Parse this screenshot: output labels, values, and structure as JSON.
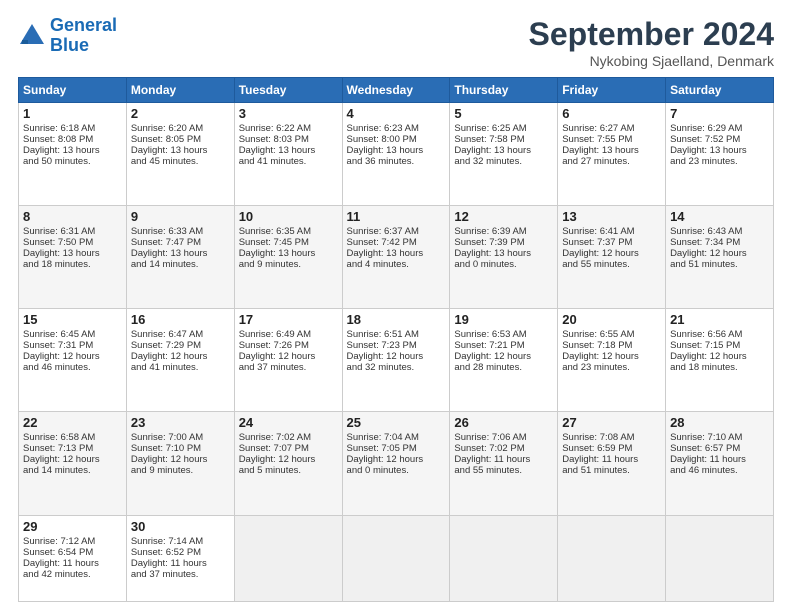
{
  "logo": {
    "line1": "General",
    "line2": "Blue"
  },
  "header": {
    "month": "September 2024",
    "location": "Nykobing Sjaelland, Denmark"
  },
  "days_of_week": [
    "Sunday",
    "Monday",
    "Tuesday",
    "Wednesday",
    "Thursday",
    "Friday",
    "Saturday"
  ],
  "weeks": [
    [
      {
        "day": "1",
        "lines": [
          "Sunrise: 6:18 AM",
          "Sunset: 8:08 PM",
          "Daylight: 13 hours",
          "and 50 minutes."
        ]
      },
      {
        "day": "2",
        "lines": [
          "Sunrise: 6:20 AM",
          "Sunset: 8:05 PM",
          "Daylight: 13 hours",
          "and 45 minutes."
        ]
      },
      {
        "day": "3",
        "lines": [
          "Sunrise: 6:22 AM",
          "Sunset: 8:03 PM",
          "Daylight: 13 hours",
          "and 41 minutes."
        ]
      },
      {
        "day": "4",
        "lines": [
          "Sunrise: 6:23 AM",
          "Sunset: 8:00 PM",
          "Daylight: 13 hours",
          "and 36 minutes."
        ]
      },
      {
        "day": "5",
        "lines": [
          "Sunrise: 6:25 AM",
          "Sunset: 7:58 PM",
          "Daylight: 13 hours",
          "and 32 minutes."
        ]
      },
      {
        "day": "6",
        "lines": [
          "Sunrise: 6:27 AM",
          "Sunset: 7:55 PM",
          "Daylight: 13 hours",
          "and 27 minutes."
        ]
      },
      {
        "day": "7",
        "lines": [
          "Sunrise: 6:29 AM",
          "Sunset: 7:52 PM",
          "Daylight: 13 hours",
          "and 23 minutes."
        ]
      }
    ],
    [
      {
        "day": "8",
        "lines": [
          "Sunrise: 6:31 AM",
          "Sunset: 7:50 PM",
          "Daylight: 13 hours",
          "and 18 minutes."
        ]
      },
      {
        "day": "9",
        "lines": [
          "Sunrise: 6:33 AM",
          "Sunset: 7:47 PM",
          "Daylight: 13 hours",
          "and 14 minutes."
        ]
      },
      {
        "day": "10",
        "lines": [
          "Sunrise: 6:35 AM",
          "Sunset: 7:45 PM",
          "Daylight: 13 hours",
          "and 9 minutes."
        ]
      },
      {
        "day": "11",
        "lines": [
          "Sunrise: 6:37 AM",
          "Sunset: 7:42 PM",
          "Daylight: 13 hours",
          "and 4 minutes."
        ]
      },
      {
        "day": "12",
        "lines": [
          "Sunrise: 6:39 AM",
          "Sunset: 7:39 PM",
          "Daylight: 13 hours",
          "and 0 minutes."
        ]
      },
      {
        "day": "13",
        "lines": [
          "Sunrise: 6:41 AM",
          "Sunset: 7:37 PM",
          "Daylight: 12 hours",
          "and 55 minutes."
        ]
      },
      {
        "day": "14",
        "lines": [
          "Sunrise: 6:43 AM",
          "Sunset: 7:34 PM",
          "Daylight: 12 hours",
          "and 51 minutes."
        ]
      }
    ],
    [
      {
        "day": "15",
        "lines": [
          "Sunrise: 6:45 AM",
          "Sunset: 7:31 PM",
          "Daylight: 12 hours",
          "and 46 minutes."
        ]
      },
      {
        "day": "16",
        "lines": [
          "Sunrise: 6:47 AM",
          "Sunset: 7:29 PM",
          "Daylight: 12 hours",
          "and 41 minutes."
        ]
      },
      {
        "day": "17",
        "lines": [
          "Sunrise: 6:49 AM",
          "Sunset: 7:26 PM",
          "Daylight: 12 hours",
          "and 37 minutes."
        ]
      },
      {
        "day": "18",
        "lines": [
          "Sunrise: 6:51 AM",
          "Sunset: 7:23 PM",
          "Daylight: 12 hours",
          "and 32 minutes."
        ]
      },
      {
        "day": "19",
        "lines": [
          "Sunrise: 6:53 AM",
          "Sunset: 7:21 PM",
          "Daylight: 12 hours",
          "and 28 minutes."
        ]
      },
      {
        "day": "20",
        "lines": [
          "Sunrise: 6:55 AM",
          "Sunset: 7:18 PM",
          "Daylight: 12 hours",
          "and 23 minutes."
        ]
      },
      {
        "day": "21",
        "lines": [
          "Sunrise: 6:56 AM",
          "Sunset: 7:15 PM",
          "Daylight: 12 hours",
          "and 18 minutes."
        ]
      }
    ],
    [
      {
        "day": "22",
        "lines": [
          "Sunrise: 6:58 AM",
          "Sunset: 7:13 PM",
          "Daylight: 12 hours",
          "and 14 minutes."
        ]
      },
      {
        "day": "23",
        "lines": [
          "Sunrise: 7:00 AM",
          "Sunset: 7:10 PM",
          "Daylight: 12 hours",
          "and 9 minutes."
        ]
      },
      {
        "day": "24",
        "lines": [
          "Sunrise: 7:02 AM",
          "Sunset: 7:07 PM",
          "Daylight: 12 hours",
          "and 5 minutes."
        ]
      },
      {
        "day": "25",
        "lines": [
          "Sunrise: 7:04 AM",
          "Sunset: 7:05 PM",
          "Daylight: 12 hours",
          "and 0 minutes."
        ]
      },
      {
        "day": "26",
        "lines": [
          "Sunrise: 7:06 AM",
          "Sunset: 7:02 PM",
          "Daylight: 11 hours",
          "and 55 minutes."
        ]
      },
      {
        "day": "27",
        "lines": [
          "Sunrise: 7:08 AM",
          "Sunset: 6:59 PM",
          "Daylight: 11 hours",
          "and 51 minutes."
        ]
      },
      {
        "day": "28",
        "lines": [
          "Sunrise: 7:10 AM",
          "Sunset: 6:57 PM",
          "Daylight: 11 hours",
          "and 46 minutes."
        ]
      }
    ],
    [
      {
        "day": "29",
        "lines": [
          "Sunrise: 7:12 AM",
          "Sunset: 6:54 PM",
          "Daylight: 11 hours",
          "and 42 minutes."
        ]
      },
      {
        "day": "30",
        "lines": [
          "Sunrise: 7:14 AM",
          "Sunset: 6:52 PM",
          "Daylight: 11 hours",
          "and 37 minutes."
        ]
      },
      null,
      null,
      null,
      null,
      null
    ]
  ]
}
